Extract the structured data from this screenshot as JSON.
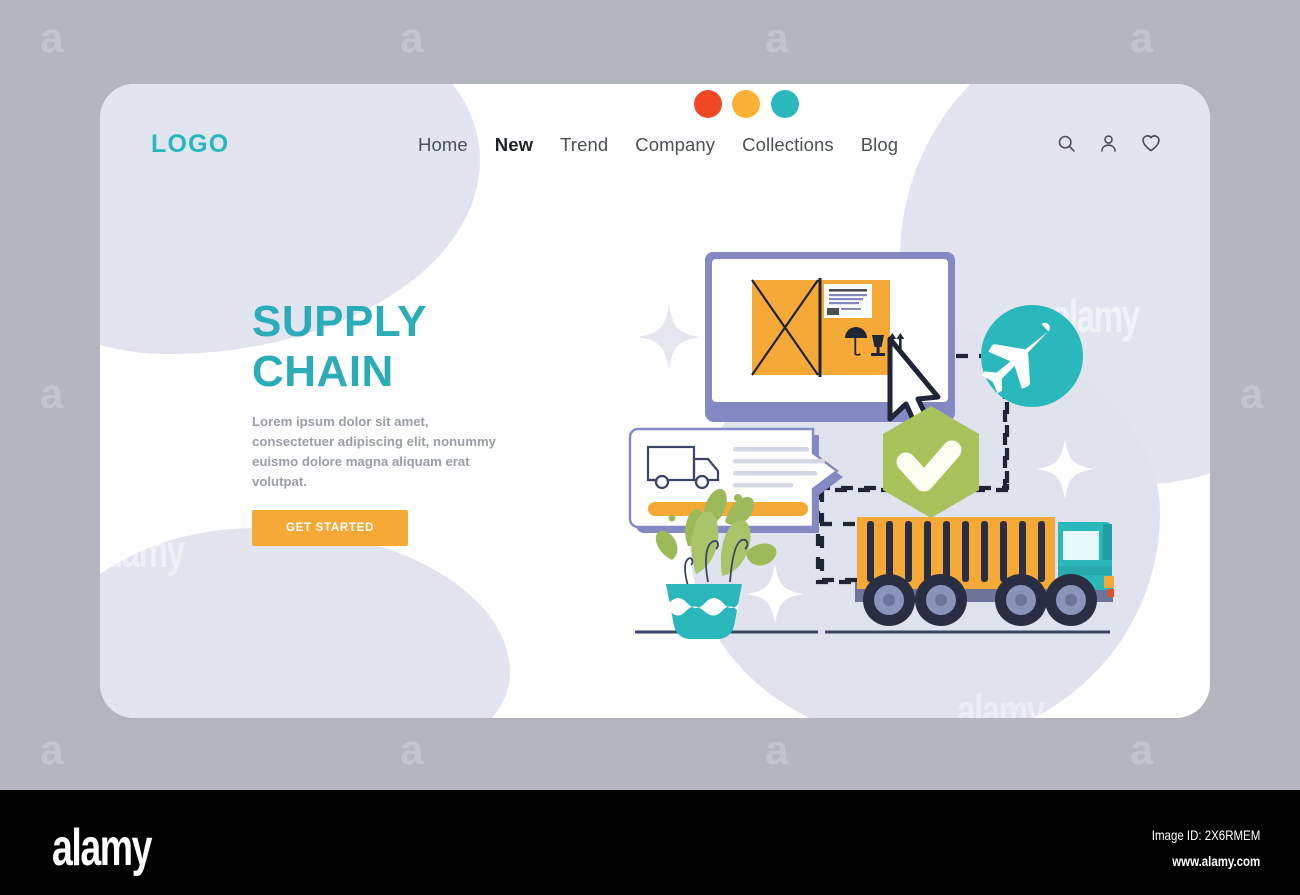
{
  "header": {
    "logo": "LOGO",
    "nav": [
      {
        "label": "Home",
        "active": false
      },
      {
        "label": "New",
        "active": true
      },
      {
        "label": "Trend",
        "active": false
      },
      {
        "label": "Company",
        "active": false
      },
      {
        "label": "Collections",
        "active": false
      },
      {
        "label": "Blog",
        "active": false
      }
    ],
    "icons": [
      "search-icon",
      "user-icon",
      "heart-icon"
    ]
  },
  "hero": {
    "title_line1": "SUPPLY",
    "title_line2": "CHAIN",
    "paragraph": "Lorem ipsum dolor sit amet, consectetuer adipiscing elit, nonummy euismo dolore magna aliquam erat volutpat.",
    "cta_label": "GET STARTED"
  },
  "illustration": {
    "window": {
      "dots": [
        "#ef4923",
        "#f9b233",
        "#2bb8bd"
      ],
      "box_label_lines": 3,
      "fragile_icons": [
        "umbrella-icon",
        "glass-icon",
        "this-way-up-icon"
      ],
      "cursor": "mouse-cursor-icon"
    },
    "notification_card": {
      "icon": "delivery-truck-icon",
      "text_lines": 4,
      "button_color": "#f7a938"
    },
    "badge": {
      "shape": "hexagon",
      "icon": "check-icon",
      "color": "#a8c25c"
    },
    "airplane": {
      "shape": "circle",
      "icon": "airplane-icon",
      "color": "#2bb8bd"
    },
    "truck": {
      "body_color": "#f7a938",
      "cab_color": "#2bb8bd",
      "wheels": 4
    },
    "plant": {
      "pot_color": "#2bb8bd",
      "leaf_color": "#9dba5a"
    },
    "sparkles": 4
  },
  "colors": {
    "teal": "#2bacb9",
    "orange": "#f7a938",
    "green": "#a8c25c",
    "periwinkle": "#8489c4",
    "page_bg": "#b3b5bf",
    "blob": "#e2e5ef"
  },
  "footer": {
    "brand": "alamy",
    "image_id": "Image ID: 2X6RMEM",
    "website": "www.alamy.com"
  },
  "watermark": {
    "glyph": "a"
  }
}
